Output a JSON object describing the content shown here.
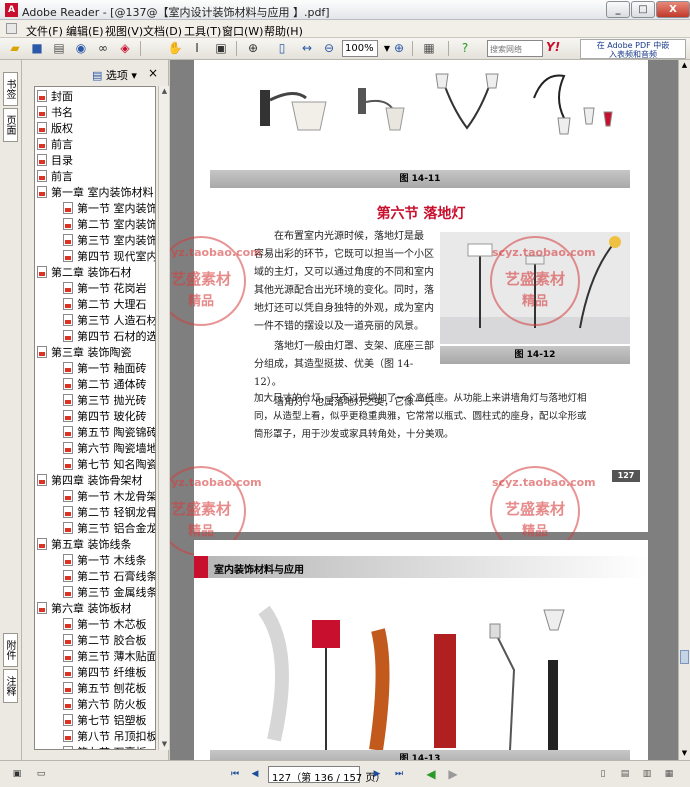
{
  "window": {
    "title": "Adobe Reader - [@137@【室内设计装饰材料与应用 】.pdf]",
    "app_icon": "A",
    "minimize_label": "_",
    "maximize_label": "□",
    "close_label": "X"
  },
  "menu": {
    "items": [
      "文件(F)",
      "编辑(E)",
      "视图(V)",
      "文档(D)",
      "工具(T)",
      "窗口(W)",
      "帮助(H)"
    ]
  },
  "toolbar": {
    "zoom_value": "100%",
    "search_placeholder": "搜索网络",
    "yahoo_label": "Y!",
    "adobe_search_line1": "在 Adobe PDF 中嵌",
    "adobe_search_line2": "入表频和音频"
  },
  "side_tabs": {
    "bookmarks": "书签",
    "pages": "页面",
    "attachments": "附件",
    "comments": "注释"
  },
  "bookmarks_panel": {
    "options_label": "选项",
    "close_label": "×",
    "items": [
      "封面",
      "书名",
      "版权",
      "前言",
      "目录",
      "前言",
      "第一章 室内装饰材料",
      "第一节 室内装饰材",
      "第二节 室内装饰",
      "第三节 室内装饰",
      "第四节 现代室内",
      "第二章 装饰石材",
      "第一节 花岗岩",
      "第二节 大理石",
      "第三节 人造石材",
      "第四节 石材的选",
      "第三章 装饰陶瓷",
      "第一节 釉面砖",
      "第二节 通体砖",
      "第三节 抛光砖",
      "第四节 玻化砖",
      "第五节 陶瓷锦砖",
      "第六节 陶瓷墙地",
      "第七节 知名陶瓷",
      "第四章 装饰骨架材",
      "第一节 木龙骨架",
      "第二节 轻钢龙骨",
      "第三节 铝合金龙",
      "第五章 装饰线条",
      "第一节 木线条",
      "第二节 石膏线条",
      "第三节 金属线条",
      "第六章 装饰板材",
      "第一节 木芯板",
      "第二节 胶合板",
      "第三节 薄木贴面",
      "第四节 纤维板",
      "第五节 刨花板",
      "第六节 防火板",
      "第七节 铝塑板",
      "第八节 吊顶扣板",
      "第九节 石膏板"
    ]
  },
  "page1": {
    "caption_top": "图 14-11",
    "section_title": "第六节 落地灯",
    "para1_lines": [
      "在布置室内光源时候，落地灯是最",
      "容易出彩的环节，它既可以担当一个小区",
      "域的主灯，又可以通过角度的不同和室内",
      "其他光源配合出光环境的变化。同时，落",
      "地灯还可以凭自身独特的外观，成为室内",
      "一件不错的摆设以及一道亮丽的风景。"
    ],
    "para2_lines": [
      "落地灯一般由灯罩、支架、底座三部",
      "分组成，其造型挺拔、优美（图 14-12）。"
    ],
    "para3_lines": [
      "墙角灯，也属落地灯之类，它像一只",
      "加大尺寸的台灯，只不过是增加了一个高低座。从功能上来讲墙角灯与落地灯相",
      "同，从造型上看，似乎更稳重典雅，它常常以瓶式、圆柱式的座身，配以伞形或",
      "筒形罩子，用于沙发或家具转角处，十分美观。"
    ],
    "figure_caption": "图 14-12",
    "page_number": "127"
  },
  "page2": {
    "chapter_header": "室内装饰材料与应用",
    "figure_caption": "图 14-13"
  },
  "watermark": {
    "line1": "scyz.taobao.com",
    "line2": "艺盛素材",
    "line3": "精品"
  },
  "statusbar": {
    "page_display": "127（第 136 / 157 页）"
  }
}
